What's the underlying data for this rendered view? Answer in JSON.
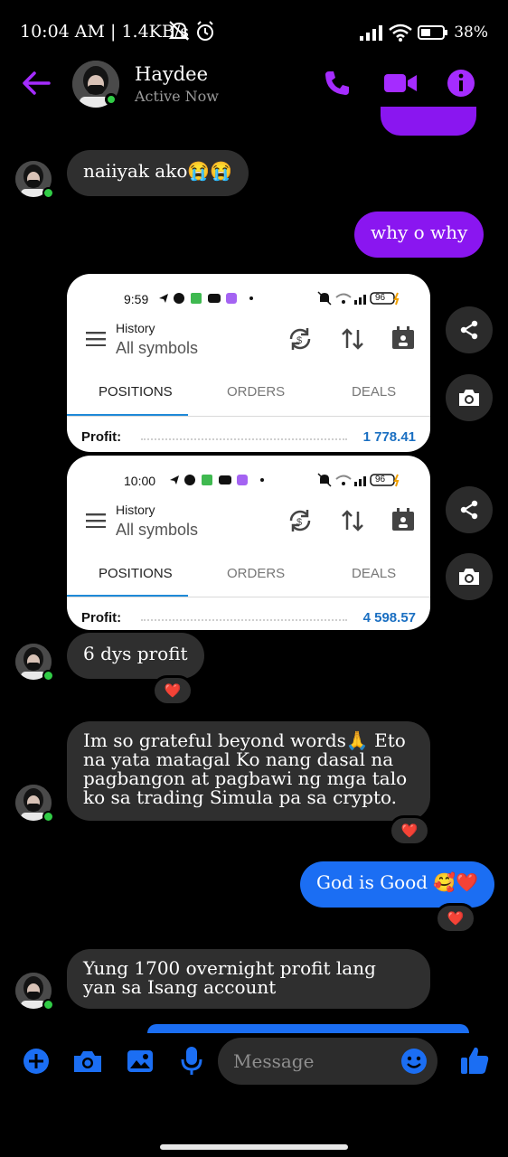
{
  "status_bar": {
    "time": "10:04 AM | 1.4KB/s",
    "battery": "38%",
    "icons": [
      "mute-icon",
      "alarm-icon",
      "signal-icon",
      "wifi-icon",
      "battery-icon"
    ]
  },
  "header": {
    "name": "Haydee",
    "status": "Active Now",
    "accent": "#a52cff"
  },
  "messages": {
    "m1": "naiiyak ako😭😭",
    "m2": "why o why",
    "m3": "6 dys profit",
    "m4": "Im so grateful beyond words🙏 Eto na yata matagal Ko nang dasal na pagbangon at pagbawi ng mga talo ko sa trading Simula pa sa crypto.",
    "m5": "God is Good 🥰❤️",
    "m6": "Yung 1700 overnight profit lang yan sa Isang account"
  },
  "reactions": {
    "heart": "❤️"
  },
  "cards": [
    {
      "time": "9:59",
      "battery": "96",
      "history": "History",
      "symbols": "All symbols",
      "tabs": [
        "POSITIONS",
        "ORDERS",
        "DEALS"
      ],
      "profit_label": "Profit:",
      "profit_value": "1 778.41"
    },
    {
      "time": "10:00",
      "battery": "96",
      "history": "History",
      "symbols": "All symbols",
      "tabs": [
        "POSITIONS",
        "ORDERS",
        "DEALS"
      ],
      "profit_label": "Profit:",
      "profit_value": "4 598.57"
    }
  ],
  "composer": {
    "placeholder": "Message",
    "icons": [
      "add-icon",
      "camera-icon",
      "image-icon",
      "mic-icon",
      "emoji-icon",
      "thumbs-up-icon"
    ],
    "accent": "#1b6ef3"
  },
  "colors": {
    "purple_bubble": "#8a16f0",
    "blue_bubble": "#1b6ef3",
    "incoming_bubble": "#2f2f2f",
    "online": "#31cc46",
    "profit_value": "#1a6fc2"
  }
}
